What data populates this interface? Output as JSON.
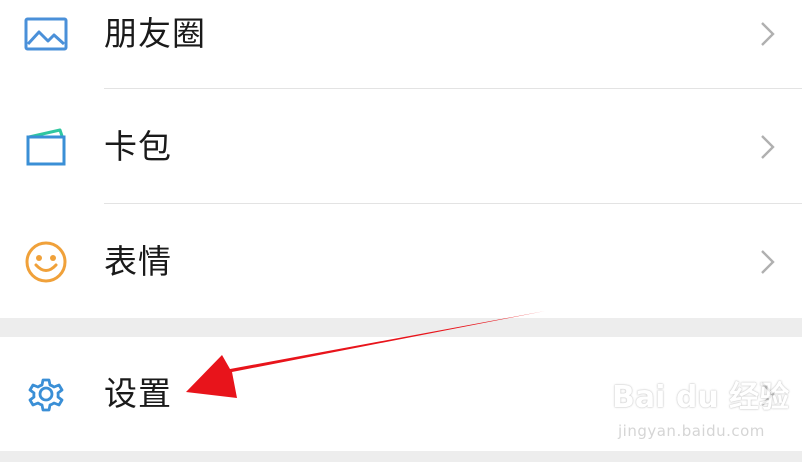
{
  "menu": {
    "group1": [
      {
        "label": "朋友圈",
        "icon": "moments-icon",
        "color": "#4a90d9"
      },
      {
        "label": "卡包",
        "icon": "card-wallet-icon",
        "color": "#3a8fd6"
      },
      {
        "label": "表情",
        "icon": "emoji-smile-icon",
        "color": "#f0a13a"
      }
    ],
    "group2": [
      {
        "label": "设置",
        "icon": "settings-gear-icon",
        "color": "#3a8fd6"
      }
    ]
  },
  "annotation": {
    "arrow_color": "#e8141b",
    "target": "设置"
  },
  "watermark": {
    "logo": "Bai du 经验",
    "url": "jingyan.baidu.com"
  }
}
